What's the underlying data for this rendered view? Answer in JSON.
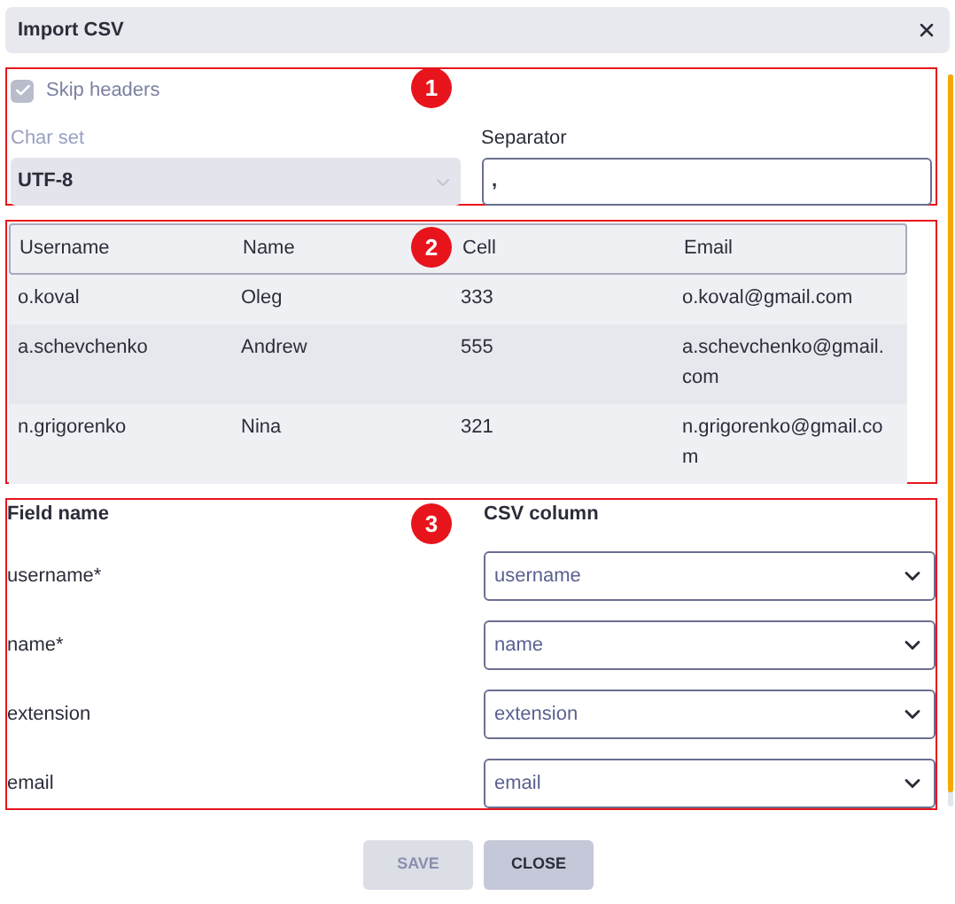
{
  "dialog": {
    "title": "Import CSV"
  },
  "sections": [
    {
      "marker": "1"
    },
    {
      "marker": "2"
    },
    {
      "marker": "3"
    }
  ],
  "skip_headers": {
    "label": "Skip headers",
    "checked": true,
    "disabled": true
  },
  "charset": {
    "label": "Char set",
    "value": "UTF-8",
    "disabled": true
  },
  "separator": {
    "label": "Separator",
    "value": ","
  },
  "table": {
    "columns": [
      "Username",
      "Name",
      "Cell",
      "Email"
    ],
    "rows": [
      [
        "o.koval",
        "Oleg",
        "333",
        "o.koval@gmail.com"
      ],
      [
        "a.schevchenko",
        "Andrew",
        "555",
        "a.schevchenko@gmail.com"
      ],
      [
        "n.grigorenko",
        "Nina",
        "321",
        "n.grigorenko@gmail.com"
      ]
    ]
  },
  "mapping": {
    "columns": [
      "Field name",
      "CSV column"
    ],
    "rows": [
      {
        "field": "username*",
        "column": "username"
      },
      {
        "field": "name*",
        "column": "name"
      },
      {
        "field": "extension",
        "column": "extension"
      },
      {
        "field": "email",
        "column": "email"
      }
    ]
  },
  "buttons": [
    {
      "label": "SAVE",
      "disabled": true
    },
    {
      "label": "CLOSE",
      "disabled": false
    }
  ]
}
